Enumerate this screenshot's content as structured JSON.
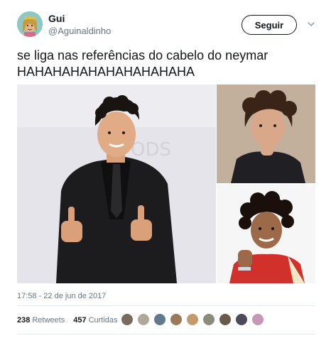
{
  "author": {
    "name": "Gui",
    "handle": "@Aguinaldinho",
    "avatar_icon": "avatar-icon"
  },
  "actions": {
    "follow_label": "Seguir",
    "more_icon": "chevron-down-icon"
  },
  "tweet": {
    "text_line1": "se liga nas referências do cabelo do neymar",
    "text_line2": "HAHAHAHAHAHAHAHAHAHA"
  },
  "media": {
    "count": 3
  },
  "meta": {
    "timestamp": "17:58 - 22 de jun de 2017"
  },
  "stats": {
    "retweets_count": "238",
    "retweets_label": "Retweets",
    "likes_count": "457",
    "likes_label": "Curtidas"
  },
  "likers": {
    "colors": [
      "#7a6a5c",
      "#b0a898",
      "#5e7a8c",
      "#9a7a5a",
      "#c49a6c",
      "#8c8c7a",
      "#6a5a4a",
      "#4a4a5a",
      "#c896b8"
    ]
  },
  "colors": {
    "text": "#14171a",
    "secondary": "#657786",
    "divider": "#e6ecf0"
  }
}
